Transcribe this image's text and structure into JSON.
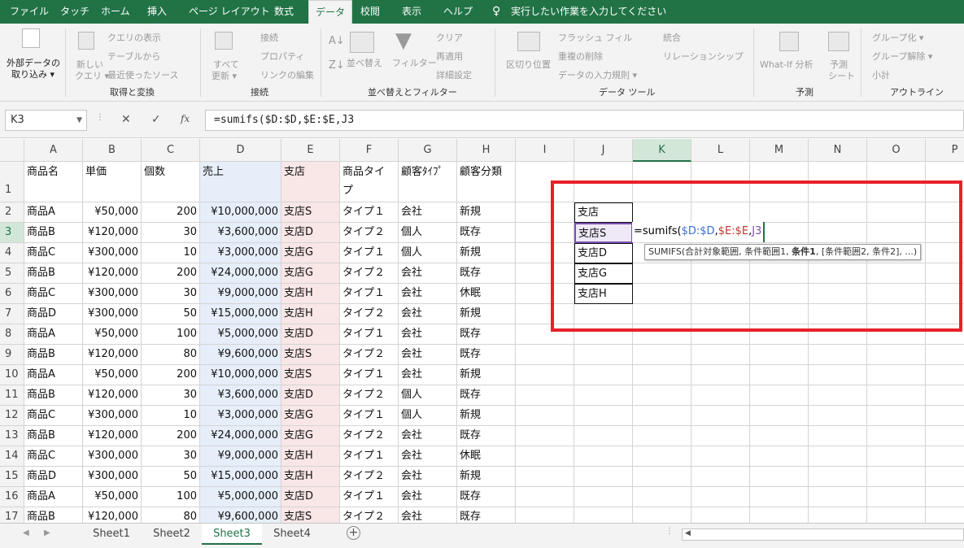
{
  "tabs": [
    "ファイル",
    "タッチ",
    "ホーム",
    "挿入",
    "ページ レイアウト",
    "数式",
    "データ",
    "校閲",
    "表示",
    "ヘルプ"
  ],
  "tell_me": "実行したい作業を入力してください",
  "ribbon": {
    "ext_data": [
      "外部データの",
      "取り込み ▾"
    ],
    "new_query": [
      "新しい",
      "クエリ ▾"
    ],
    "show_query": "クエリの表示",
    "from_table": "テーブルから",
    "recent_sources": "最近使ったソース",
    "get_transform": "取得と変換",
    "refresh_all": [
      "すべて",
      "更新 ▾"
    ],
    "connections": "接続",
    "properties": "プロパティ",
    "edit_links": "リンクの編集",
    "conn_group": "接続",
    "sort": "並べ替え",
    "filter": "フィルター",
    "clear": "クリア",
    "reapply": "再適用",
    "advanced": "詳細設定",
    "sort_group": "並べ替えとフィルター",
    "text_to_cols": "区切り位置",
    "flash_fill": "フラッシュ フィル",
    "remove_dup": "重複の削除",
    "validation": "データの入力規則 ▾",
    "consolidate": "統合",
    "relationships": "リレーションシップ",
    "data_tools": "データ ツール",
    "whatif": "What-If 分析",
    "forecast_sheet": [
      "予測",
      "シート"
    ],
    "forecast_group": "予測",
    "group": "グループ化 ▾",
    "ungroup": "グループ解除 ▾",
    "subtotal": "小計",
    "outline": "アウトライン"
  },
  "formula_bar": {
    "name_box": "K3",
    "fx": "fx",
    "cancel": "✕",
    "enter": "✓",
    "formula": "=sumifs($D:$D,$E:$E,J3"
  },
  "columns": [
    "A",
    "B",
    "C",
    "D",
    "E",
    "F",
    "G",
    "H",
    "I",
    "J",
    "K",
    "L",
    "M",
    "N",
    "O",
    "P"
  ],
  "rows": [
    "1",
    "2",
    "3",
    "4",
    "5",
    "6",
    "7",
    "8",
    "9",
    "10",
    "11",
    "12",
    "13",
    "14",
    "15",
    "16",
    "17"
  ],
  "headers": [
    "商品名",
    "単価",
    "個数",
    "売上",
    "支店",
    "商品タイ",
    "顧客ﾀｲﾌﾟ",
    "顧客分類"
  ],
  "header_f_line2": "プ",
  "table": [
    [
      "商品A",
      "¥50,000",
      "200",
      "¥10,000,000",
      "支店S",
      "タイプ１",
      "会社",
      "新規"
    ],
    [
      "商品B",
      "¥120,000",
      "30",
      "¥3,600,000",
      "支店D",
      "タイプ２",
      "個人",
      "既存"
    ],
    [
      "商品C",
      "¥300,000",
      "10",
      "¥3,000,000",
      "支店G",
      "タイプ１",
      "個人",
      "新規"
    ],
    [
      "商品B",
      "¥120,000",
      "200",
      "¥24,000,000",
      "支店G",
      "タイプ２",
      "会社",
      "既存"
    ],
    [
      "商品C",
      "¥300,000",
      "30",
      "¥9,000,000",
      "支店H",
      "タイプ１",
      "会社",
      "休眠"
    ],
    [
      "商品D",
      "¥300,000",
      "50",
      "¥15,000,000",
      "支店H",
      "タイプ２",
      "会社",
      "新規"
    ],
    [
      "商品A",
      "¥50,000",
      "100",
      "¥5,000,000",
      "支店D",
      "タイプ１",
      "会社",
      "既存"
    ],
    [
      "商品B",
      "¥120,000",
      "80",
      "¥9,600,000",
      "支店S",
      "タイプ２",
      "会社",
      "既存"
    ],
    [
      "商品A",
      "¥50,000",
      "200",
      "¥10,000,000",
      "支店S",
      "タイプ１",
      "会社",
      "新規"
    ],
    [
      "商品B",
      "¥120,000",
      "30",
      "¥3,600,000",
      "支店D",
      "タイプ２",
      "個人",
      "既存"
    ],
    [
      "商品C",
      "¥300,000",
      "10",
      "¥3,000,000",
      "支店G",
      "タイプ１",
      "個人",
      "新規"
    ],
    [
      "商品B",
      "¥120,000",
      "200",
      "¥24,000,000",
      "支店G",
      "タイプ２",
      "会社",
      "既存"
    ],
    [
      "商品C",
      "¥300,000",
      "30",
      "¥9,000,000",
      "支店H",
      "タイプ１",
      "会社",
      "休眠"
    ],
    [
      "商品D",
      "¥300,000",
      "50",
      "¥15,000,000",
      "支店H",
      "タイプ２",
      "会社",
      "新規"
    ],
    [
      "商品A",
      "¥50,000",
      "100",
      "¥5,000,000",
      "支店D",
      "タイプ１",
      "会社",
      "既存"
    ],
    [
      "商品B",
      "¥120,000",
      "80",
      "¥9,600,000",
      "支店S",
      "タイプ２",
      "会社",
      "既存"
    ]
  ],
  "side_list": [
    "支店",
    "支店S",
    "支店D",
    "支店G",
    "支店H"
  ],
  "cell_formula": {
    "eq": "=sumifs(",
    "a1": "$D:$D",
    "c1": ",",
    "a2": "$E:$E",
    "c2": ",",
    "a3": "J3"
  },
  "tooltip": {
    "pre": "SUMIFS(合計対象範囲, 条件範囲1, ",
    "bold": "条件1",
    "post": ", [条件範囲2, 条件2], ...)"
  },
  "sheets": [
    "Sheet1",
    "Sheet2",
    "Sheet3",
    "Sheet4"
  ],
  "active_sheet": "Sheet3",
  "add_sheet": "+",
  "colors": {
    "accent": "#217346",
    "highlight_box": "#e8212a",
    "ref_blue": "#3b6fd6",
    "ref_red": "#c0392b",
    "ref_purple": "#7b4fb5"
  }
}
